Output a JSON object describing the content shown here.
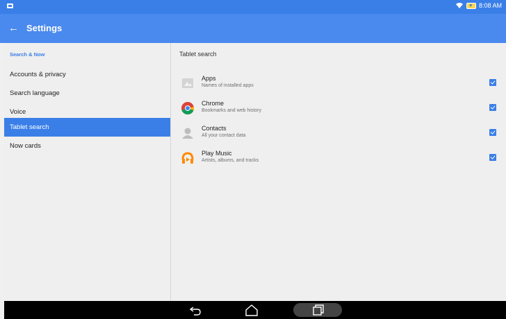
{
  "status": {
    "time": "8:08 AM",
    "icons": [
      "notification-icon",
      "wifi-icon",
      "battery-charging-icon"
    ]
  },
  "appbar": {
    "title": "Settings",
    "back_icon": "arrow-back-icon"
  },
  "sidebar": {
    "section_label": "Search & Now",
    "items": [
      {
        "label": "Accounts & privacy",
        "active": false
      },
      {
        "label": "Search language",
        "active": false
      },
      {
        "label": "Voice",
        "active": false
      },
      {
        "label": "Tablet search",
        "active": true
      },
      {
        "label": "Now cards",
        "active": false
      }
    ]
  },
  "panel": {
    "title": "Tablet search",
    "rows": [
      {
        "title": "Apps",
        "subtitle": "Names of installed apps",
        "icon": "apps-icon",
        "checked": true
      },
      {
        "title": "Chrome",
        "subtitle": "Bookmarks and web history",
        "icon": "chrome-icon",
        "checked": true
      },
      {
        "title": "Contacts",
        "subtitle": "All your contact data",
        "icon": "contacts-icon",
        "checked": true
      },
      {
        "title": "Play Music",
        "subtitle": "Artists, albums, and tracks",
        "icon": "play-music-icon",
        "checked": true
      }
    ]
  },
  "navbar": {
    "buttons": [
      "back-nav-icon",
      "home-nav-icon",
      "recents-nav-icon"
    ]
  },
  "colors": {
    "accent": "#3a7fe8",
    "appbar": "#4a89ee",
    "background": "#efefef"
  }
}
